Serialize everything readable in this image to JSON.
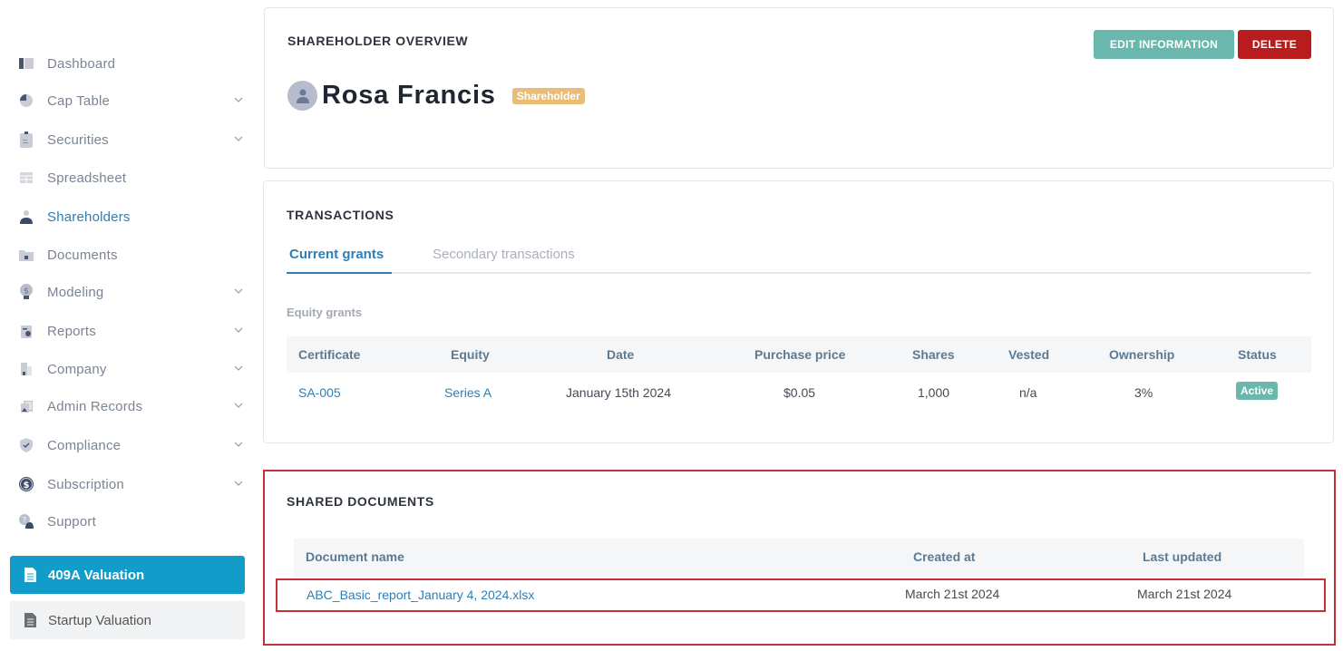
{
  "sidebar": {
    "items": [
      {
        "label": "Dashboard",
        "icon": "dashboard-icon",
        "has_chevron": false,
        "active": false
      },
      {
        "label": "Cap Table",
        "icon": "pie-chart-icon",
        "has_chevron": true,
        "active": false
      },
      {
        "label": "Securities",
        "icon": "clipboard-icon",
        "has_chevron": true,
        "active": false
      },
      {
        "label": "Spreadsheet",
        "icon": "spreadsheet-icon",
        "has_chevron": false,
        "active": false
      },
      {
        "label": "Shareholders",
        "icon": "person-icon",
        "has_chevron": false,
        "active": true
      },
      {
        "label": "Documents",
        "icon": "folder-lock-icon",
        "has_chevron": false,
        "active": false
      },
      {
        "label": "Modeling",
        "icon": "lightbulb-dollar-icon",
        "has_chevron": true,
        "active": false
      },
      {
        "label": "Reports",
        "icon": "report-icon",
        "has_chevron": true,
        "active": false
      },
      {
        "label": "Company",
        "icon": "building-icon",
        "has_chevron": true,
        "active": false
      },
      {
        "label": "Admin Records",
        "icon": "records-icon",
        "has_chevron": true,
        "active": false
      },
      {
        "label": "Compliance",
        "icon": "shield-check-icon",
        "has_chevron": true,
        "active": false
      },
      {
        "label": "Subscription",
        "icon": "dollar-circle-icon",
        "has_chevron": true,
        "active": false
      },
      {
        "label": "Support",
        "icon": "support-chat-icon",
        "has_chevron": false,
        "active": false
      }
    ],
    "valuation_409a": "409A Valuation",
    "startup_valuation": "Startup Valuation"
  },
  "overview": {
    "title": "SHAREHOLDER OVERVIEW",
    "name": "Rosa Francis",
    "role_badge": "Shareholder",
    "edit_button": "EDIT INFORMATION",
    "delete_button": "DELETE"
  },
  "transactions": {
    "title": "TRANSACTIONS",
    "tabs": [
      "Current grants",
      "Secondary transactions"
    ],
    "active_tab": "Current grants",
    "section_label": "Equity grants",
    "columns": [
      "Certificate",
      "Equity",
      "Date",
      "Purchase price",
      "Shares",
      "Vested",
      "Ownership",
      "Status"
    ],
    "rows": [
      {
        "certificate": "SA-005",
        "equity": "Series A",
        "date": "January 15th 2024",
        "purchase_price": "$0.05",
        "shares": "1,000",
        "vested": "n/a",
        "ownership": "3%",
        "status": "Active"
      }
    ]
  },
  "shared_documents": {
    "title": "SHARED DOCUMENTS",
    "columns": [
      "Document name",
      "Created at",
      "Last updated"
    ],
    "rows": [
      {
        "name": "ABC_Basic_report_January 4, 2024.xlsx",
        "created_at": "March 21st 2024",
        "last_updated": "March 21st 2024"
      }
    ]
  },
  "colors": {
    "accent_blue": "#2f7fb5",
    "primary_button": "#129cc9",
    "edit_button": "#6ab8ad",
    "delete_button": "#b91c1c",
    "badge_shareholder": "#e9bd77",
    "highlight_outline": "#c62f37"
  }
}
